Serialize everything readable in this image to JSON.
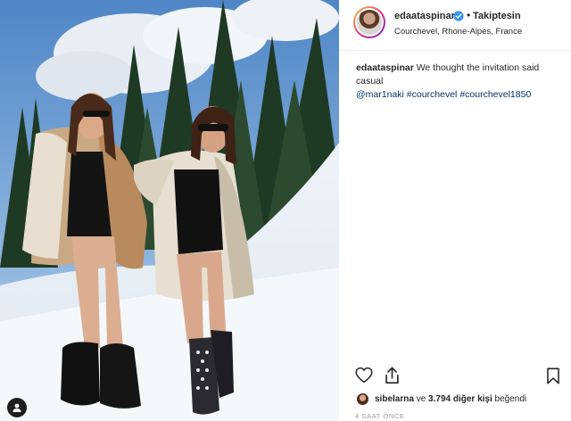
{
  "header": {
    "username": "edaataspinar",
    "separator": "•",
    "follow_label": "Takiptesin",
    "location": "Courchevel, Rhone-Alpes, France"
  },
  "caption": {
    "username": "edaataspinar",
    "text": "We thought the invitation said casual",
    "mention": "@mar1naki",
    "hashtag1": "#courchevel",
    "hashtag2": "#courchevel1850"
  },
  "likes": {
    "liker": "sibelarna",
    "connector": "ve",
    "others": "3.794 diğer kişi",
    "suffix": "beğendi"
  },
  "timestamp": "4 SAAT ÖNCE",
  "icons": {
    "heart": "heart-icon",
    "share": "share-icon",
    "save": "bookmark-icon",
    "verified": "verified-badge-icon",
    "user_tag": "user-tag-icon"
  },
  "colors": {
    "link": "#003569",
    "verified": "#3897f0",
    "text": "#262626",
    "muted": "#999999"
  }
}
